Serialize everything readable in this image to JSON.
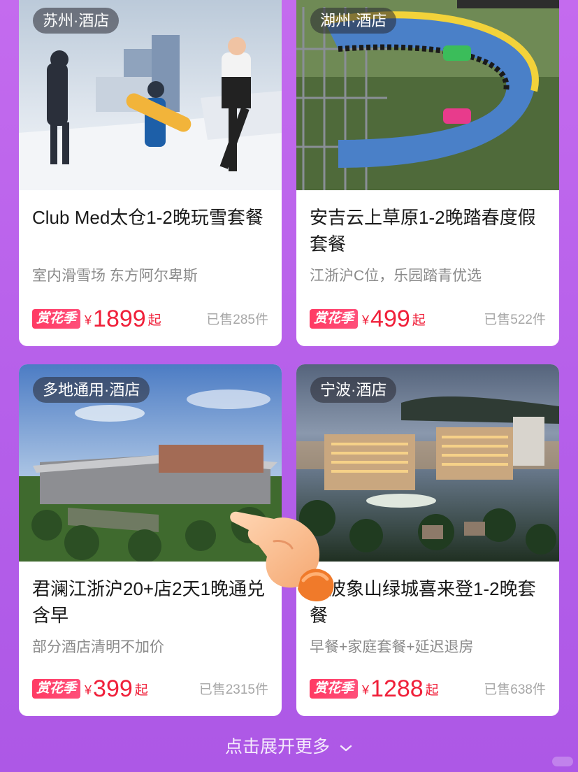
{
  "cards": [
    {
      "location": "苏州·酒店",
      "title": "Club Med太仓1-2晚玩雪套餐",
      "subtitle": "室内滑雪场 东方阿尔卑斯",
      "badge": "赏花季",
      "currency": "¥",
      "price": "1899",
      "price_suffix": "起",
      "sold": "已售285件"
    },
    {
      "location": "湖州·酒店",
      "title": "安吉云上草原1-2晚踏春度假套餐",
      "subtitle": "江浙沪C位，乐园踏青优选",
      "badge": "赏花季",
      "currency": "¥",
      "price": "499",
      "price_suffix": "起",
      "sold": "已售522件"
    },
    {
      "location": "多地通用·酒店",
      "title": "君澜江浙沪20+店2天1晚通兑含早",
      "subtitle": "部分酒店清明不加价",
      "badge": "赏花季",
      "currency": "¥",
      "price": "399",
      "price_suffix": "起",
      "sold": "已售2315件"
    },
    {
      "location": "宁波·酒店",
      "title": "宁波象山绿城喜来登1-2晚套餐",
      "subtitle": "早餐+家庭套餐+延迟退房",
      "badge": "赏花季",
      "currency": "¥",
      "price": "1288",
      "price_suffix": "起",
      "sold": "已售638件"
    }
  ],
  "footer": {
    "more_label": "点击展开更多"
  },
  "icons": {
    "expand": "chevron-down-icon",
    "pointer": "pointing-hand-icon"
  },
  "colors": {
    "price": "#f0203a",
    "badge": "#ff3a63",
    "background": "#b660ea"
  }
}
